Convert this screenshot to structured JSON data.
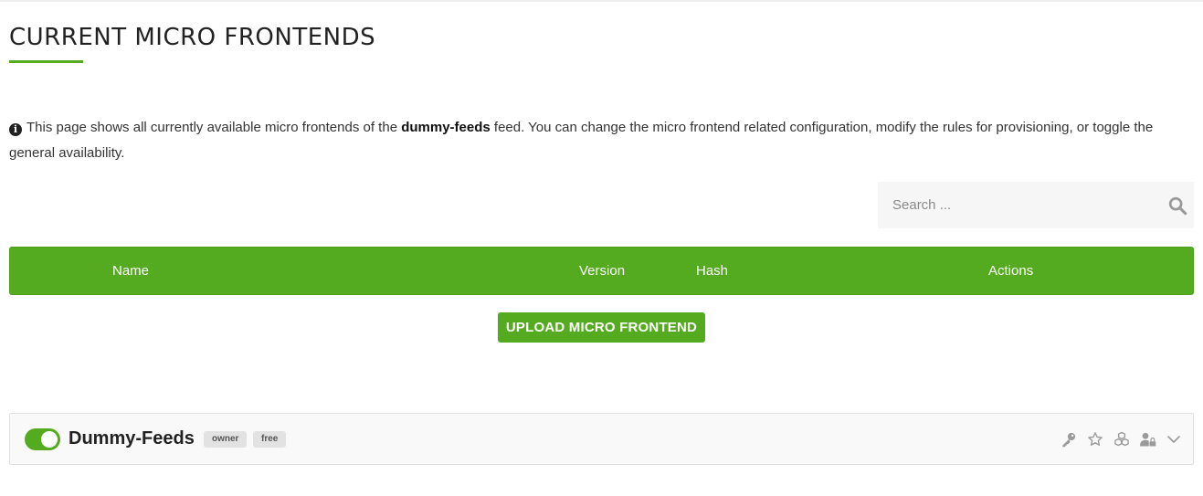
{
  "page": {
    "title": "CURRENT MICRO FRONTENDS",
    "info": {
      "icon": "info-circle-icon",
      "text_before": "This page shows all currently available micro frontends of the ",
      "feed_name": "dummy-feeds",
      "text_after": " feed. You can change the micro frontend related configuration, modify the rules for provisioning, or toggle the general availability."
    }
  },
  "search": {
    "placeholder": "Search ...",
    "value": "",
    "icon": "search-icon"
  },
  "table": {
    "columns": [
      "Name",
      "Version",
      "Hash",
      "Actions"
    ]
  },
  "upload_button": {
    "label": "UPLOAD MICRO FRONTEND"
  },
  "feed": {
    "name": "Dummy-Feeds",
    "enabled": true,
    "tags": [
      "owner",
      "free"
    ],
    "action_icons": [
      "key-icon",
      "star-icon",
      "cubes-icon",
      "user-lock-icon",
      "chevron-down-icon"
    ]
  },
  "colors": {
    "accent": "#55ab1f",
    "header_text": "#ffffff",
    "tag_background": "#e2e2e2",
    "action_icon": "#9a9a9a"
  }
}
